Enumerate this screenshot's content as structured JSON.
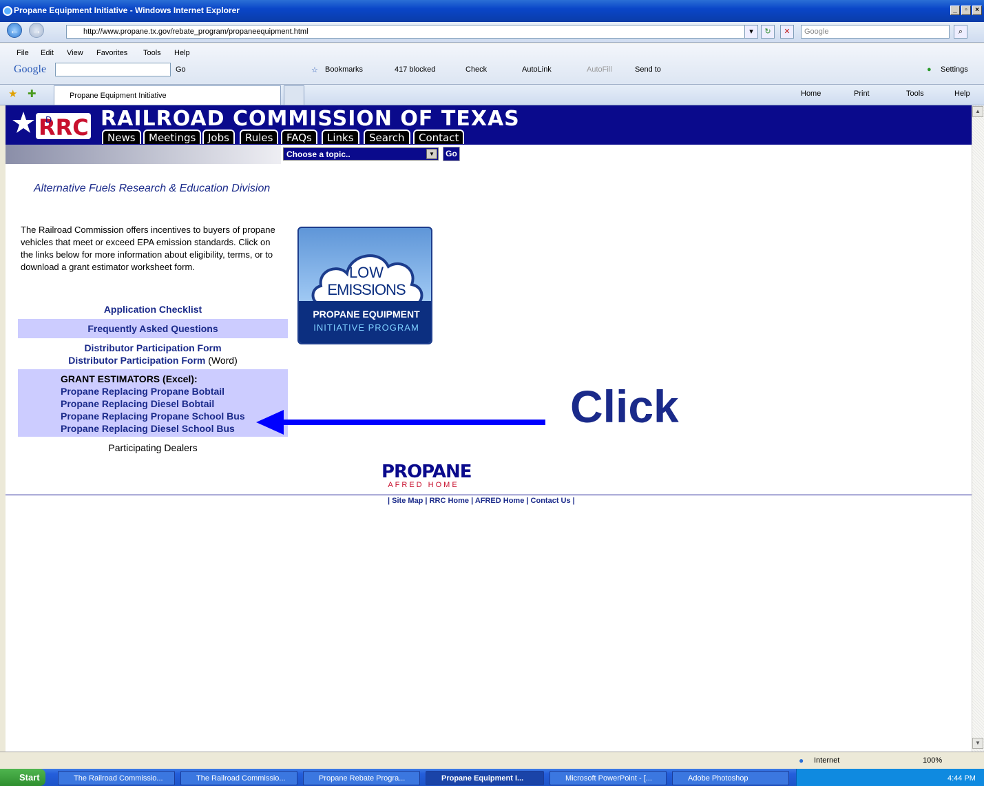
{
  "window": {
    "title": "Propane Equipment Initiative - Windows Internet Explorer"
  },
  "address": {
    "url": "http://www.propane.tx.gov/rebate_program/propaneequipment.html",
    "search_placeholder": "Google"
  },
  "menu": [
    "File",
    "Edit",
    "View",
    "Favorites",
    "Tools",
    "Help"
  ],
  "google_toolbar": {
    "logo": "Google",
    "go": "Go",
    "bookmarks": "Bookmarks",
    "blocked": "417 blocked",
    "check": "Check",
    "autolink": "AutoLink",
    "autofill": "AutoFill",
    "sendto": "Send to",
    "settings": "Settings"
  },
  "tab": {
    "label": "Propane Equipment Initiative"
  },
  "commands": {
    "home": "Home",
    "print": "Print",
    "tools": "Tools",
    "help": "Help"
  },
  "site": {
    "title": "RAILROAD COMMISSION OF TEXAS",
    "nav": [
      "News",
      "Meetings",
      "Jobs",
      "Rules",
      "FAQs",
      "Links",
      "Search",
      "Contact"
    ],
    "topic_select": "Choose a topic..",
    "go": "Go",
    "division": "Alternative Fuels Research & Education Division"
  },
  "content": {
    "intro": "The Railroad Commission offers incentives to buyers of propane vehicles that meet or exceed EPA emission standards. Click on the links below for more information about eligibility, terms, or to download a grant estimator worksheet form.",
    "checklist": "Application Checklist",
    "faq": "Frequently Asked Questions",
    "dist_form": "Distributor Participation Form",
    "dist_form_word": "Distributor Participation Form",
    "word_suffix": "(Word)",
    "grant_header": "GRANT ESTIMATORS (Excel):",
    "grants": [
      "Propane Replacing Propane Bobtail",
      "Propane Replacing Diesel Bobtail",
      "Propane Replacing Propane School Bus",
      "Propane Replacing Diesel School Bus"
    ],
    "dealers": "Participating Dealers",
    "badge": {
      "line1": "LOW",
      "line2": "EMISSIONS",
      "line3": "PROPANE EQUIPMENT",
      "line4": "INITIATIVE PROGRAM"
    },
    "annotation": "Click"
  },
  "footer": {
    "logo": "PROPANE",
    "sublogo": "AFRED HOME",
    "links": [
      "Site Map",
      "RRC Home",
      "AFRED Home",
      "Contact Us"
    ]
  },
  "status": {
    "zone": "Internet",
    "zoom": "100%"
  },
  "taskbar": {
    "start": "Start",
    "tasks": [
      "The Railroad Commissio...",
      "The Railroad Commissio...",
      "Propane Rebate Progra...",
      "Propane Equipment I...",
      "Microsoft PowerPoint - [...",
      "Adobe Photoshop"
    ],
    "clock": "4:44 PM"
  }
}
